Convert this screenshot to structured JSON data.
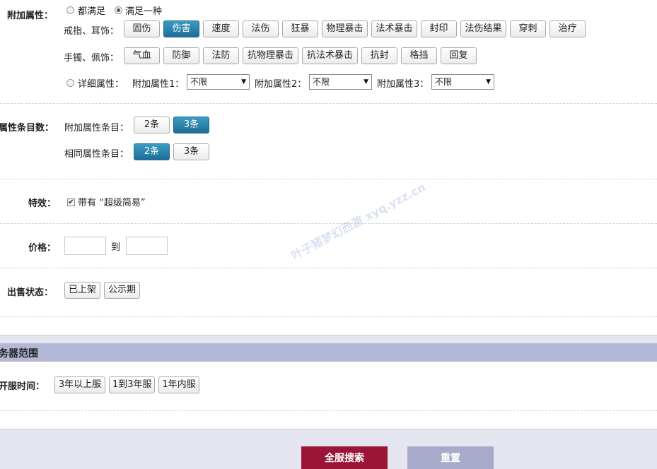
{
  "extra_attrs": {
    "label": "附加属性：",
    "mode_options": [
      "都满足",
      "满足一种"
    ],
    "ring_label": "戒指、耳饰：",
    "ring_buttons": [
      "固伤",
      "伤害",
      "速度",
      "法伤",
      "狂暴",
      "物理暴击",
      "法术暴击",
      "封印",
      "法伤结果",
      "穿刺",
      "治疗"
    ],
    "bracelet_label": "手镯、佩饰：",
    "bracelet_buttons": [
      "气血",
      "防御",
      "法防",
      "抗物理暴击",
      "抗法术暴击",
      "抗封",
      "格挡",
      "回复"
    ],
    "detail_label": "详细属性：",
    "selects": [
      {
        "label": "附加属性1：",
        "value": "不限"
      },
      {
        "label": "附加属性2：",
        "value": "不限"
      },
      {
        "label": "附加属性3：",
        "value": "不限"
      }
    ]
  },
  "attr_count": {
    "label": "属性条目数：",
    "extra_label": "附加属性条目：",
    "extra_buttons": [
      "2条",
      "3条"
    ],
    "same_label": "相同属性条目：",
    "same_buttons": [
      "2条",
      "3条"
    ]
  },
  "effect": {
    "label": "特效：",
    "checkbox_label": "带有 “超级简易”",
    "check_mark": "✔"
  },
  "price": {
    "label": "价格：",
    "to": "到"
  },
  "sale_status": {
    "label": "出售状态：",
    "buttons": [
      "已上架",
      "公示期"
    ]
  },
  "server": {
    "header": "务器范围",
    "open_label": "开服时间：",
    "buttons": [
      "3年以上服",
      "1到3年服",
      "1年内服"
    ]
  },
  "footer": {
    "search_label": "全服搜索",
    "reset_label": "重置"
  },
  "watermark": "叶子猪梦幻西游 xyq.yzz.cn",
  "colors": {
    "active_button": "#2a86b0",
    "section_header_bg": "#b3b8d6",
    "search_button": "#9a1538",
    "reset_button": "#a7abc9"
  }
}
